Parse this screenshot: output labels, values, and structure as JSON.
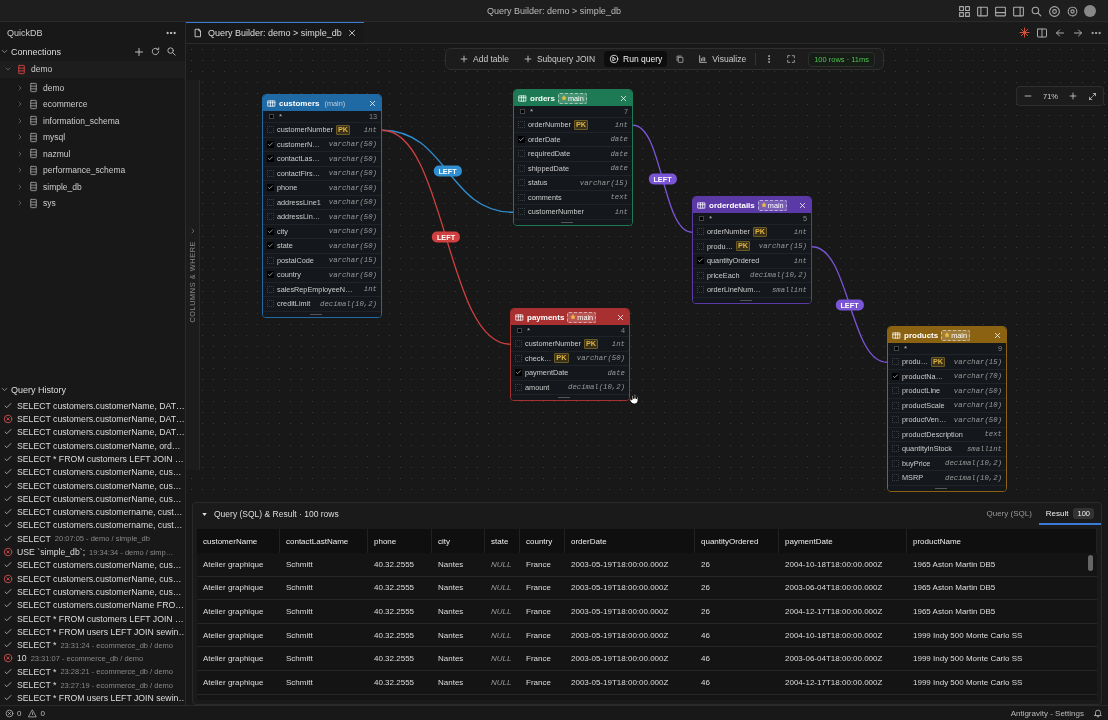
{
  "title_bar": {
    "title": "Query Builder: demo > simple_db"
  },
  "sidebar": {
    "title": "QuickDB",
    "connections": {
      "label": "Connections",
      "expanded": true,
      "items": [
        {
          "label": "demo",
          "expanded": true,
          "children": [
            {
              "label": "demo",
              "expanded": false
            },
            {
              "label": "ecommerce",
              "expanded": false
            },
            {
              "label": "information_schema",
              "expanded": false
            },
            {
              "label": "mysql",
              "expanded": false
            },
            {
              "label": "nazmul",
              "expanded": false
            },
            {
              "label": "performance_schema",
              "expanded": false
            },
            {
              "label": "simple_db",
              "expanded": false
            },
            {
              "label": "sys",
              "expanded": false
            }
          ]
        }
      ]
    }
  },
  "query_history": {
    "label": "Query History",
    "expanded": true,
    "items": [
      {
        "query": "SELECT customers.customerName, DAT…",
        "failed": false
      },
      {
        "query": "SELECT customers.customerName, DAT…",
        "failed": true
      },
      {
        "query": "SELECT customers.customerName, DAT…",
        "failed": false
      },
      {
        "query": "SELECT customers.customerName,  ord…",
        "failed": false
      },
      {
        "query": "SELECT * FROM customers LEFT JOIN …",
        "failed": false
      },
      {
        "query": "SELECT customers.customerName, cus…",
        "failed": false
      },
      {
        "query": "SELECT customers.customerName, cus…",
        "failed": false
      },
      {
        "query": "SELECT customers.customerName, cus…",
        "failed": false
      },
      {
        "query": "SELECT customers.customername, cust…",
        "failed": false
      },
      {
        "query": "SELECT customers.customername, cust…",
        "failed": false
      },
      {
        "query": "SELECT",
        "meta": "20:07:05 - demo / simple_db",
        "failed": false
      },
      {
        "query": "USE `simple_db`;",
        "meta": "19:34:34 - demo / simp…",
        "failed": true
      },
      {
        "query": "SELECT customers.customerName, cus…",
        "failed": false
      },
      {
        "query": "SELECT customers.customerName, cus…",
        "failed": true
      },
      {
        "query": "SELECT customers.customerName, cus…",
        "failed": false
      },
      {
        "query": "SELECT customers.customerName FRO…",
        "failed": false
      },
      {
        "query": "SELECT * FROM customers LEFT JOIN …",
        "failed": false
      },
      {
        "query": "SELECT * FROM users LEFT JOIN sewin…",
        "failed": false
      },
      {
        "query": "SELECT *",
        "meta": "23:31:24 - ecommerce_db / demo",
        "failed": false
      },
      {
        "query": "10",
        "meta": "23:31:07 - ecommerce_db / demo",
        "failed": true
      },
      {
        "query": "SELECT *",
        "meta": "23:28:21 - ecommerce_db / demo",
        "failed": false
      },
      {
        "query": "SELECT *",
        "meta": "23:27:19 - ecommerce_db / demo",
        "failed": false
      },
      {
        "query": "SELECT * FROM users LEFT JOIN sewin…",
        "failed": false
      }
    ]
  },
  "editor_tabs": [
    {
      "label": "Query Builder: demo > simple_db",
      "selected": true
    }
  ],
  "toolbar": {
    "buttons": [
      {
        "label": "Add table",
        "kind": "add"
      },
      {
        "label": "Subquery JOIN",
        "kind": "add"
      },
      {
        "label": "Run query",
        "kind": "run"
      },
      {
        "label": "Visualize",
        "kind": "chart"
      }
    ],
    "status": "100 rows · 11ms"
  },
  "zoom": {
    "value": "71%"
  },
  "side_panel": {
    "label": "COLUMNS & WHERE"
  },
  "tables": [
    {
      "name": "customers",
      "badge": "(main)",
      "starred": false,
      "color": "#1f6aa5",
      "all": "*",
      "count": "13",
      "columns": [
        {
          "name": "customerNumber",
          "key": "PK",
          "type": "int",
          "checked": false
        },
        {
          "name": "customerN…",
          "type": "varchar(50)",
          "checked": true
        },
        {
          "name": "contactLas…",
          "type": "varchar(50)",
          "checked": true
        },
        {
          "name": "contactFirs…",
          "type": "varchar(50)",
          "checked": false
        },
        {
          "name": "phone",
          "type": "varchar(50)",
          "checked": true
        },
        {
          "name": "addressLine1",
          "type": "varchar(50)",
          "checked": false
        },
        {
          "name": "addressLin…",
          "type": "varchar(50)",
          "checked": false
        },
        {
          "name": "city",
          "type": "varchar(50)",
          "checked": true
        },
        {
          "name": "state",
          "type": "varchar(50)",
          "checked": true
        },
        {
          "name": "postalCode",
          "type": "varchar(15)",
          "checked": false
        },
        {
          "name": "country",
          "type": "varchar(50)",
          "checked": true
        },
        {
          "name": "salesRepEmployeeN…",
          "type": "int",
          "checked": false
        },
        {
          "name": "creditLimit",
          "type": "decimal(10,2)",
          "checked": false
        }
      ]
    },
    {
      "name": "orders",
      "badge": "main",
      "starred": true,
      "color": "#1d7a55",
      "all": "*",
      "count": "7",
      "columns": [
        {
          "name": "orderNumber",
          "key": "PK",
          "type": "int",
          "checked": false
        },
        {
          "name": "orderDate",
          "type": "date",
          "checked": true
        },
        {
          "name": "requiredDate",
          "type": "date",
          "checked": false
        },
        {
          "name": "shippedDate",
          "type": "date",
          "checked": false
        },
        {
          "name": "status",
          "type": "varchar(15)",
          "checked": false
        },
        {
          "name": "comments",
          "type": "text",
          "checked": false
        },
        {
          "name": "customerNumber",
          "type": "int",
          "checked": false
        }
      ]
    },
    {
      "name": "payments",
      "badge": "main",
      "starred": true,
      "color": "#a83030",
      "all": "*",
      "count": "4",
      "columns": [
        {
          "name": "customerNumber",
          "key": "PK",
          "type": "int",
          "checked": false
        },
        {
          "name": "check…",
          "key": "PK",
          "type": "varchar(50)",
          "checked": false
        },
        {
          "name": "paymentDate",
          "type": "date",
          "checked": true
        },
        {
          "name": "amount",
          "type": "decimal(10,2)",
          "checked": false
        }
      ]
    },
    {
      "name": "orderdetails",
      "badge": "main",
      "starred": true,
      "color": "#5b3aa8",
      "all": "*",
      "count": "5",
      "columns": [
        {
          "name": "orderNumber",
          "key": "PK",
          "type": "int",
          "checked": false
        },
        {
          "name": "produ…",
          "key": "PK",
          "type": "varchar(15)",
          "checked": false
        },
        {
          "name": "quantityOrdered",
          "type": "int",
          "checked": true
        },
        {
          "name": "priceEach",
          "type": "decimal(10,2)",
          "checked": false
        },
        {
          "name": "orderLineNum…",
          "type": "smallint",
          "checked": false
        }
      ]
    },
    {
      "name": "products",
      "badge": "main",
      "starred": true,
      "color": "#8a6212",
      "all": "*",
      "count": "9",
      "columns": [
        {
          "name": "produ…",
          "key": "PK",
          "type": "varchar(15)",
          "checked": false
        },
        {
          "name": "productNa…",
          "type": "varchar(70)",
          "checked": true
        },
        {
          "name": "productLine",
          "type": "varchar(50)",
          "checked": false
        },
        {
          "name": "productScale",
          "type": "varchar(10)",
          "checked": false
        },
        {
          "name": "productVen…",
          "type": "varchar(50)",
          "checked": false
        },
        {
          "name": "productDescription",
          "type": "text",
          "checked": false
        },
        {
          "name": "quantityInStock",
          "type": "smallint",
          "checked": false
        },
        {
          "name": "buyPrice",
          "type": "decimal(10,2)",
          "checked": false
        },
        {
          "name": "MSRP",
          "type": "decimal(10,2)",
          "checked": false
        }
      ]
    }
  ],
  "joins": [
    {
      "label": "LEFT",
      "color": "#2f8fd0"
    },
    {
      "label": "LEFT",
      "color": "#d04040"
    },
    {
      "label": "LEFT",
      "color": "#7a55d6"
    },
    {
      "label": "LEFT",
      "color": "#7a55d6"
    }
  ],
  "results": {
    "title": "Query (SQL) & Result · 100 rows",
    "expanded": true,
    "tabs": [
      {
        "label": "Query (SQL)",
        "selected": false
      },
      {
        "label": "Result",
        "count": "100",
        "selected": true
      }
    ],
    "columns": [
      {
        "label": "customerName",
        "muted": false
      },
      {
        "label": "contactLastName",
        "muted": false
      },
      {
        "label": "phone",
        "muted": false
      },
      {
        "label": "city",
        "muted": false
      },
      {
        "label": "state",
        "muted": true
      },
      {
        "label": "country",
        "muted": false
      },
      {
        "label": "orderDate",
        "muted": false
      },
      {
        "label": "quantityOrdered",
        "muted": false
      },
      {
        "label": "paymentDate",
        "muted": false
      },
      {
        "label": "productName",
        "muted": false
      }
    ],
    "rows": [
      [
        "Atelier graphique",
        "Schmitt",
        "40.32.2555",
        "Nantes",
        "NULL",
        "France",
        "2003-05-19T18:00:00.000Z",
        "26",
        "2004-10-18T18:00:00.000Z",
        "1965 Aston Martin DB5"
      ],
      [
        "Atelier graphique",
        "Schmitt",
        "40.32.2555",
        "Nantes",
        "NULL",
        "France",
        "2003-05-19T18:00:00.000Z",
        "26",
        "2003-06-04T18:00:00.000Z",
        "1965 Aston Martin DB5"
      ],
      [
        "Atelier graphique",
        "Schmitt",
        "40.32.2555",
        "Nantes",
        "NULL",
        "France",
        "2003-05-19T18:00:00.000Z",
        "26",
        "2004-12-17T18:00:00.000Z",
        "1965 Aston Martin DB5"
      ],
      [
        "Atelier graphique",
        "Schmitt",
        "40.32.2555",
        "Nantes",
        "NULL",
        "France",
        "2003-05-19T18:00:00.000Z",
        "46",
        "2004-10-18T18:00:00.000Z",
        "1999 Indy 500 Monte Carlo SS"
      ],
      [
        "Atelier graphique",
        "Schmitt",
        "40.32.2555",
        "Nantes",
        "NULL",
        "France",
        "2003-05-19T18:00:00.000Z",
        "46",
        "2003-06-04T18:00:00.000Z",
        "1999 Indy 500 Monte Carlo SS"
      ],
      [
        "Atelier graphique",
        "Schmitt",
        "40.32.2555",
        "Nantes",
        "NULL",
        "France",
        "2003-05-19T18:00:00.000Z",
        "46",
        "2004-12-17T18:00:00.000Z",
        "1999 Indy 500 Monte Carlo SS"
      ]
    ]
  },
  "status_bar": {
    "errors": "0",
    "warnings": "0",
    "settings": "Antigravity - Settings"
  }
}
